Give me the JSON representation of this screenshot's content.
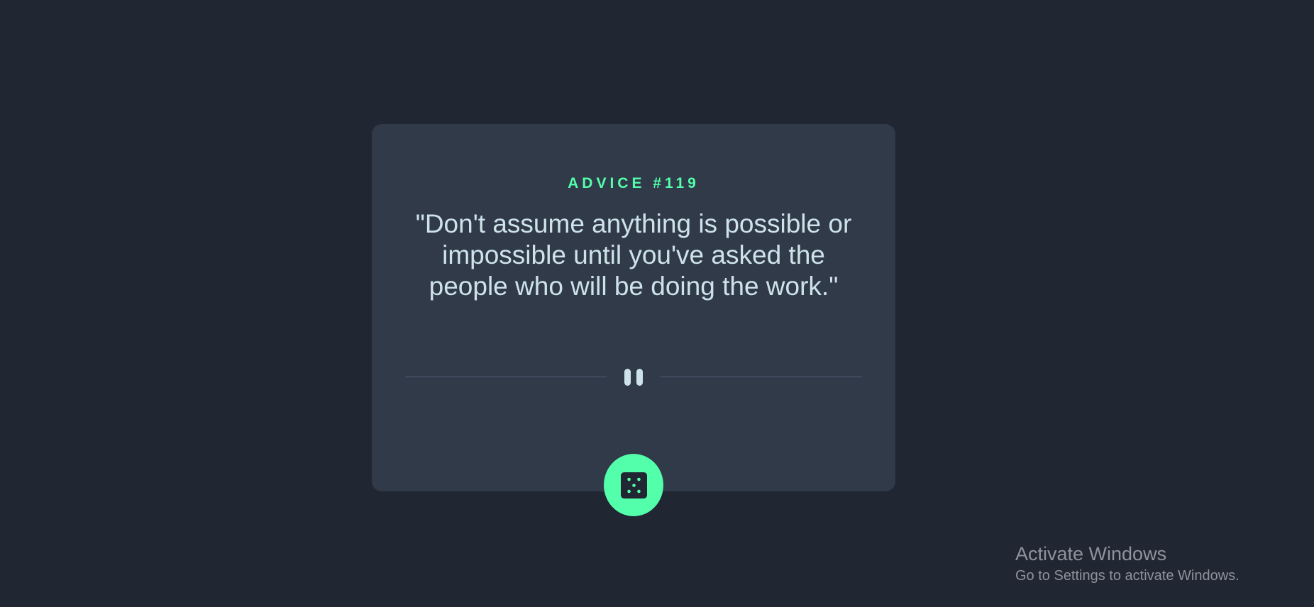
{
  "advice": {
    "id_label": "ADVICE #119",
    "text": "\"Don't assume anything is possible or impossible until you've asked the people who will be doing the work.\""
  },
  "divider": {
    "icon": "pause-icon"
  },
  "dice_button": {
    "icon": "dice-icon"
  },
  "watermark": {
    "title": "Activate Windows",
    "subtitle": "Go to Settings to activate Windows."
  },
  "colors": {
    "background": "#202632",
    "card": "#313a49",
    "accent": "#53ffaa",
    "text": "#cee3e9",
    "divider": "#4f5d74"
  }
}
